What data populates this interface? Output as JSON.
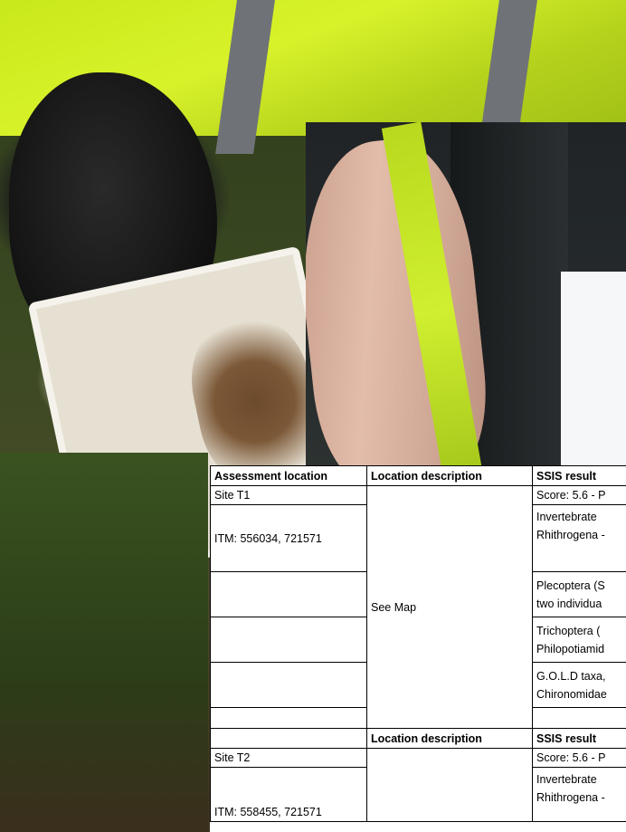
{
  "table": {
    "header1": {
      "col1": "Assessment location",
      "col2": "Location description",
      "col3": "SSIS result"
    },
    "site1": {
      "name": "Site T1",
      "itm": "ITM: 556034, 721571",
      "location": "See Map",
      "results": [
        "Score: 5.6 - P",
        "Invertebrate",
        "Rhithrogena -",
        "Plecoptera (S",
        "two individua",
        "Trichoptera (",
        "Philopotiamid",
        "G.O.L.D taxa,",
        "Chironomidae"
      ]
    },
    "header2": {
      "col1": "",
      "col2": "Location description",
      "col3": "SSIS result"
    },
    "site2": {
      "name": "Site T2",
      "itm": "ITM: 558455, 721571",
      "results": [
        "Score: 5.6 - P",
        "Invertebrate",
        "Rhithrogena -"
      ]
    }
  }
}
